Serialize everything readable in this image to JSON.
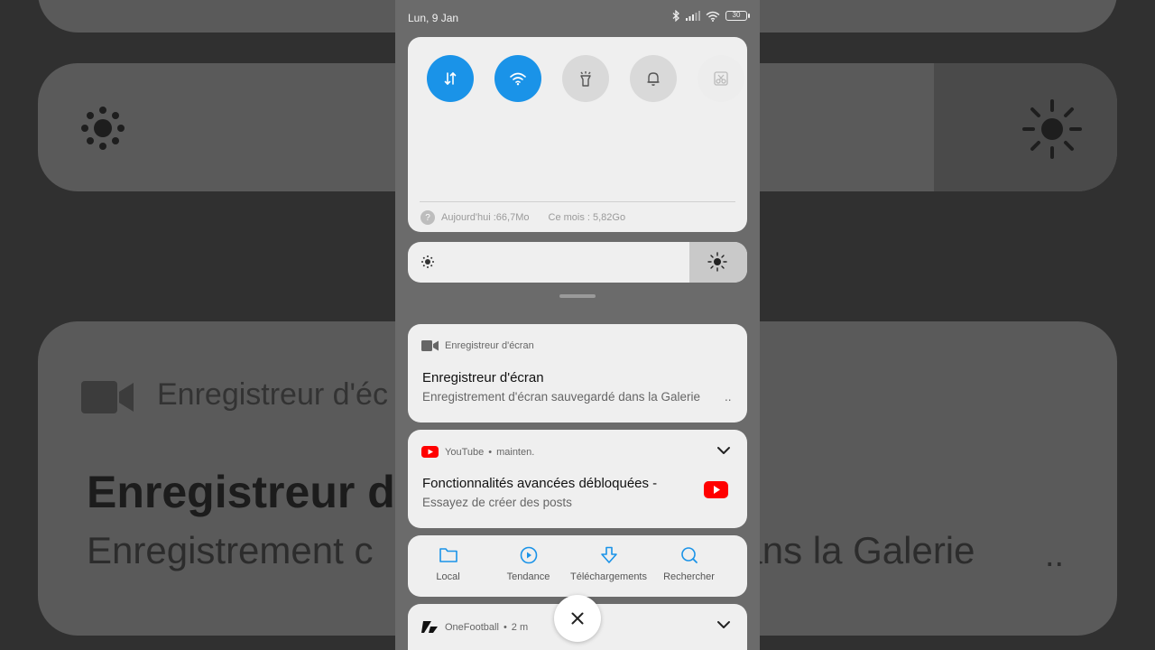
{
  "status": {
    "date": "Lun, 9 Jan",
    "battery": "30"
  },
  "quick_settings": {
    "toggles": [
      {
        "name": "mobile-data",
        "icon": "data-arrows-icon",
        "state": "on"
      },
      {
        "name": "wifi",
        "icon": "wifi-icon",
        "state": "on"
      },
      {
        "name": "flashlight",
        "icon": "flashlight-icon",
        "state": "off"
      },
      {
        "name": "sound",
        "icon": "bell-icon",
        "state": "off"
      },
      {
        "name": "screenshot",
        "icon": "scissors-icon",
        "state": "disabled"
      }
    ],
    "data_help": "?",
    "data_today": "Aujourd'hui :66,7Mo",
    "data_month": "Ce mois : 5,82Go"
  },
  "brightness": {
    "level": 0.83
  },
  "notifications": {
    "screen_recorder": {
      "app": "Enregistreur d'écran",
      "title": "Enregistreur d'écran",
      "text": "Enregistrement d'écran sauvegardé dans la Galerie",
      "ellipsis": ".."
    },
    "youtube": {
      "app": "YouTube",
      "time": "mainten.",
      "title": "Fonctionnalités avancées débloquées -",
      "text": "Essayez de créer des posts"
    },
    "youtube_actions": [
      {
        "label": "Local",
        "icon": "folder-icon"
      },
      {
        "label": "Tendance",
        "icon": "play-circle-icon"
      },
      {
        "label": "Téléchargements",
        "icon": "download-icon"
      },
      {
        "label": "Rechercher",
        "icon": "search-icon"
      }
    ],
    "onefootball": {
      "app": "OneFootball",
      "time": "2 m"
    }
  },
  "background": {
    "app": "Enregistreur d'éc",
    "title": "Enregistreur d'e",
    "text_left": "Enregistrement c",
    "text_right": "dans la Galerie",
    "ellipsis": ".."
  },
  "colors": {
    "accent": "#1a93e8",
    "youtube_red": "#ff0000"
  }
}
